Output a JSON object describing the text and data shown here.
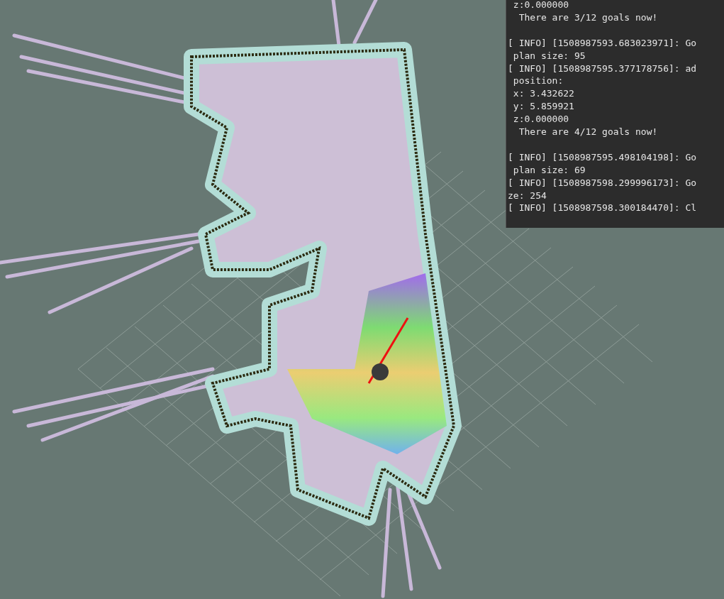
{
  "terminal": {
    "blocks": [
      {
        "lines": [
          " z:0.000000",
          "  There are 3/12 goals now!"
        ]
      },
      {
        "lines": [
          "[ INFO] [1508987593.683023971]: Go",
          " plan size: 95",
          "[ INFO] [1508987595.377178756]: ad",
          " position:",
          " x: 3.432622",
          " y: 5.859921",
          " z:0.000000",
          "  There are 4/12 goals now!"
        ]
      },
      {
        "lines": [
          "[ INFO] [1508987595.498104198]: Go",
          " plan size: 69",
          "[ INFO] [1508987598.299996173]: Go",
          "ze: 254",
          "[ INFO] [1508987598.300184470]: Cl"
        ]
      }
    ]
  }
}
